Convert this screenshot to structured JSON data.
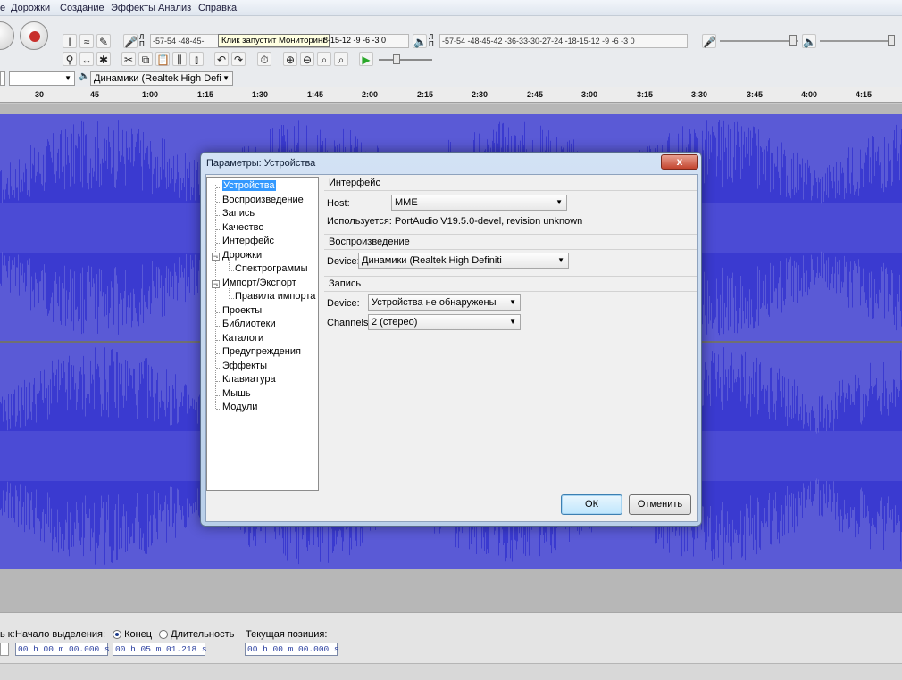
{
  "menu": [
    "е",
    "Дорожки",
    "Создание",
    "Эффекты",
    "Анализ",
    "Справка"
  ],
  "toolbar": {
    "record_meter_label": "Л\nП",
    "record_meter_ticks": "-57-54     -48-45-",
    "tooltip": "Клик запустит Мониторинг",
    "record_meter_tail": "8-15-12 -9 -6 -3 0",
    "play_meter_label": "Л\nП",
    "play_meter_ticks": "-57-54     -48-45-42     -36-33-30-27-24     -18-15-12 -9 -6 -3 0",
    "output_device": "Динамики (Realtek High Defi",
    "host_combo": ""
  },
  "ruler": {
    "ticks": [
      "30",
      "45",
      "1:00",
      "1:15",
      "1:30",
      "1:45",
      "2:00",
      "2:15",
      "2:30",
      "2:45",
      "3:00",
      "3:15",
      "3:30",
      "3:45",
      "4:00",
      "4:15"
    ]
  },
  "dialog": {
    "title": "Параметры: Устройства",
    "close": "x",
    "tree": [
      {
        "label": "Устройства",
        "selected": true
      },
      {
        "label": "Воспроизведение"
      },
      {
        "label": "Запись"
      },
      {
        "label": "Качество"
      },
      {
        "label": "Интерфейс"
      },
      {
        "label": "Дорожки",
        "expander": "−"
      },
      {
        "label": "Спектрограммы",
        "child": true
      },
      {
        "label": "Импорт/Экспорт",
        "expander": "−"
      },
      {
        "label": "Правила импорта",
        "child": true
      },
      {
        "label": "Проекты"
      },
      {
        "label": "Библиотеки"
      },
      {
        "label": "Каталоги"
      },
      {
        "label": "Предупреждения"
      },
      {
        "label": "Эффекты"
      },
      {
        "label": "Клавиатура"
      },
      {
        "label": "Мышь"
      },
      {
        "label": "Модули"
      }
    ],
    "interface": {
      "title": "Интерфейс",
      "host_label": "Host:",
      "host_value": "MME",
      "using_text": "Используется: PortAudio V19.5.0-devel, revision unknown"
    },
    "playback": {
      "title": "Воспроизведение",
      "device_label": "Device:",
      "device_value": "Динамики (Realtek High Definiti"
    },
    "recording": {
      "title": "Запись",
      "device_label": "Device:",
      "device_value": "Устройства не обнаружены",
      "channels_label": "Channels:",
      "channels_value": "2 (стерео)"
    },
    "ok": "ОК",
    "cancel": "Отменить"
  },
  "status": {
    "snap_label": "ь к:",
    "selection_start_label": "Начало выделения:",
    "end_label": "Конец",
    "length_label": "Длительность",
    "position_label": "Текущая позиция:",
    "start_time": "00 h 00 m 00.000 s",
    "end_time": "00 h 05 m 01.218 s",
    "position_time": "00 h 00 m 00.000 s"
  },
  "colors": {
    "waveform": "#3a3ad0",
    "waveform_bg": "#5a5ad6",
    "track_bg": "#b7b7b7"
  }
}
